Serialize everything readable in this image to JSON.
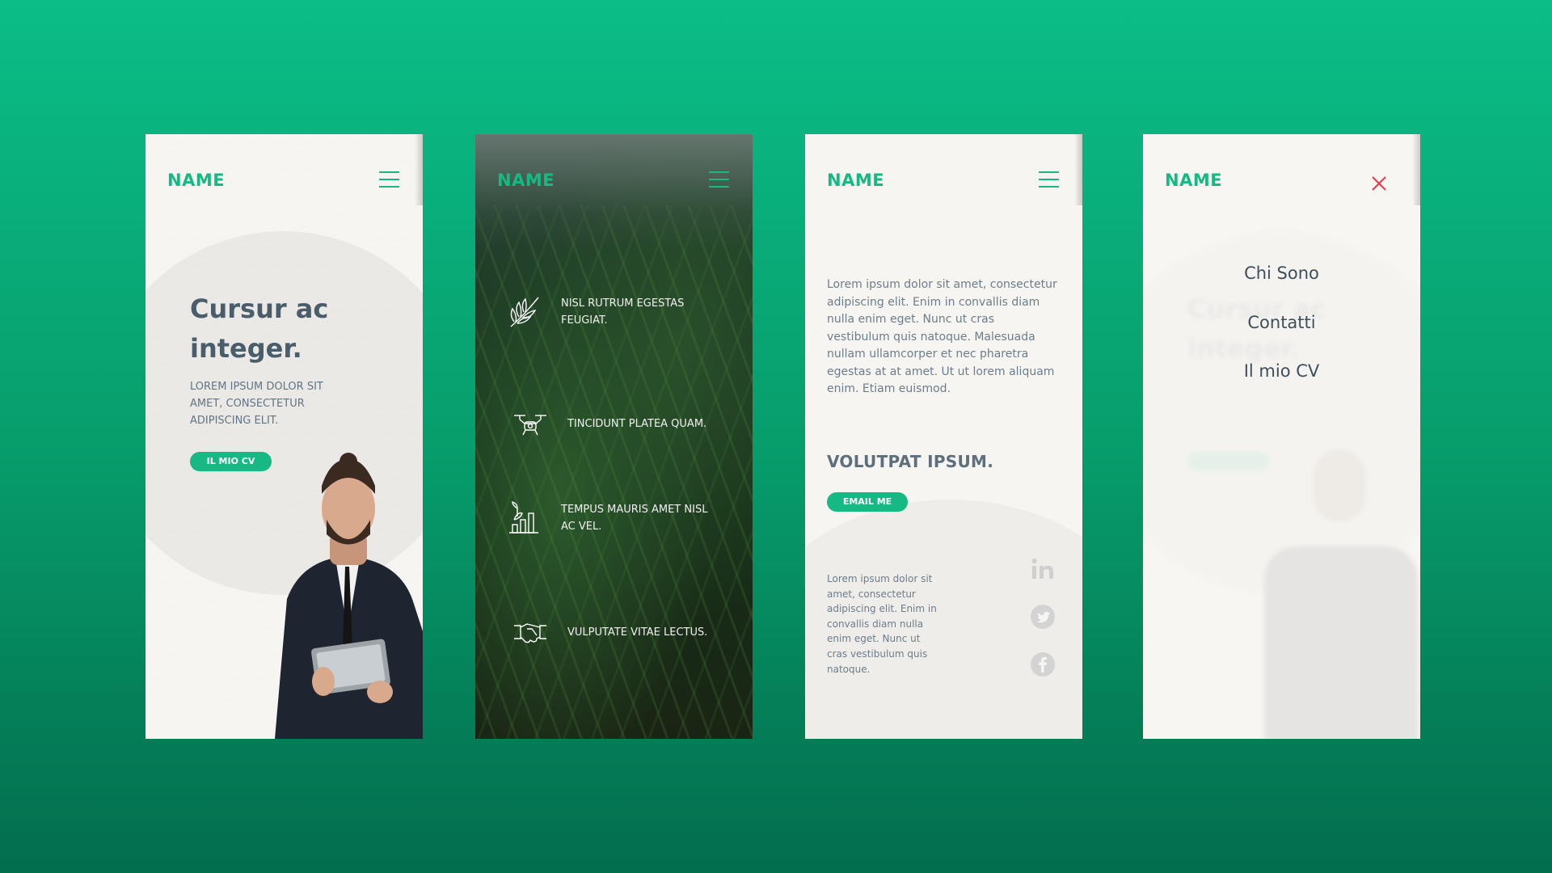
{
  "brand_color": "#16b884",
  "screens": [
    {
      "brand": "NAME",
      "menu_icon": "hamburger-icon",
      "title_line1": "Cursur ac",
      "title_line2": "integer.",
      "subtitle": "LOREM IPSUM DOLOR SIT AMET, CONSECTETUR ADIPISCING ELIT.",
      "button": "IL MIO CV"
    },
    {
      "brand": "NAME",
      "menu_icon": "hamburger-icon",
      "features": [
        {
          "icon": "leaf-branch-icon",
          "text": "NISL RUTRUM EGESTAS FEUGIAT."
        },
        {
          "icon": "drone-icon",
          "text": "TINCIDUNT PLATEA QUAM."
        },
        {
          "icon": "growth-chart-icon",
          "text": "TEMPUS MAURIS AMET NISL AC VEL."
        },
        {
          "icon": "handshake-icon",
          "text": "VULPUTATE VITAE LECTUS."
        }
      ]
    },
    {
      "brand": "NAME",
      "menu_icon": "hamburger-icon",
      "body": "Lorem ipsum dolor sit amet, consectetur adipiscing elit. Enim in convallis diam nulla enim eget. Nunc ut cras vestibulum quis natoque. Malesuada nullam ullamcorper et nec pharetra egestas at at amet. Ut ut lorem aliquam enim. Etiam euismod.",
      "heading": "VOLUTPAT IPSUM.",
      "button": "EMAIL ME",
      "small_text": "Lorem ipsum dolor sit amet, consectetur adipiscing elit. Enim in convallis diam nulla enim eget. Nunc ut cras vestibulum quis natoque.",
      "social": [
        "linkedin-icon",
        "twitter-icon",
        "facebook-icon"
      ]
    },
    {
      "brand": "NAME",
      "close_icon": "close-icon",
      "menu": [
        "Chi Sono",
        "Contatti",
        "Il mio CV"
      ]
    }
  ]
}
